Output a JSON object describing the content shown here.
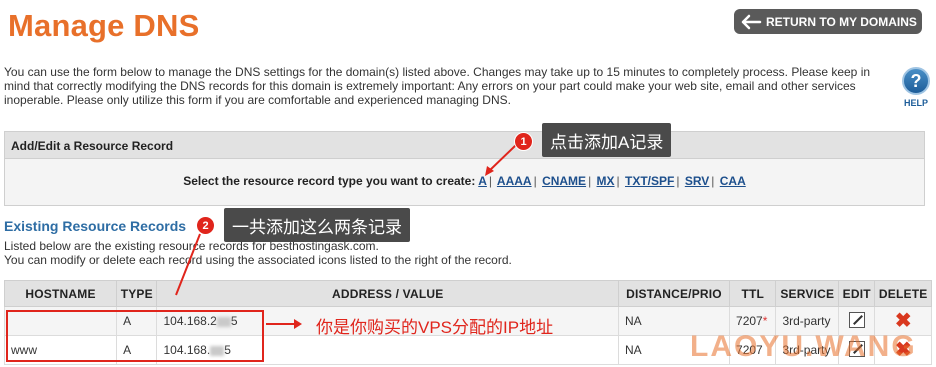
{
  "header": {
    "title": "Manage DNS",
    "return_label": "RETURN TO MY DOMAINS"
  },
  "intro_text": "You can use the form below to manage the DNS settings for the domain(s) listed above. Changes may take up to 15 minutes to completely process. Please keep in mind that correctly modifying the DNS records for this domain is extremely important: Any errors on your part could make your web site, email and other services inoperable. Please only utilize this form if you are comfortable and experienced managing DNS.",
  "help": {
    "label": "HELP",
    "icon": "question-icon",
    "glyph": "?"
  },
  "add_panel": {
    "title": "Add/Edit a Resource Record",
    "prompt": "Select the resource record type you want to create:",
    "types": [
      "A",
      "AAAA",
      "CNAME",
      "MX",
      "TXT/SPF",
      "SRV",
      "CAA"
    ]
  },
  "existing": {
    "title": "Existing Resource Records",
    "desc1": "Listed below are the existing resource records for besthostingask.com.",
    "desc2": "You can modify or delete each record using the associated icons listed to the right of the record."
  },
  "table": {
    "headers": [
      "HOSTNAME",
      "TYPE",
      "ADDRESS / VALUE",
      "DISTANCE/PRIO",
      "TTL",
      "SERVICE",
      "EDIT",
      "DELETE"
    ],
    "rows": [
      {
        "hostname": "",
        "type": "A",
        "address_prefix": "104.168.2",
        "address_suffix": "5",
        "prio": "NA",
        "ttl": "7207",
        "ttl_mark": "*",
        "service": "3rd-party"
      },
      {
        "hostname": "www",
        "type": "A",
        "address_prefix": "104.168.",
        "address_suffix": "5",
        "prio": "NA",
        "ttl": "7207",
        "ttl_mark": "",
        "service": "3rd-party"
      }
    ]
  },
  "annotations": {
    "n1": "1",
    "n1_text": "点击添加A记录",
    "n2": "2",
    "n2_text": "一共添加这么两条记录",
    "ip_note": "你是你购买的VPS分配的IP地址"
  },
  "watermark": "LAOYU.WANG",
  "colors": {
    "title": "#e8702a",
    "accent_red": "#e0251c",
    "link": "#1d4f8c",
    "section_title": "#2e6da4"
  }
}
